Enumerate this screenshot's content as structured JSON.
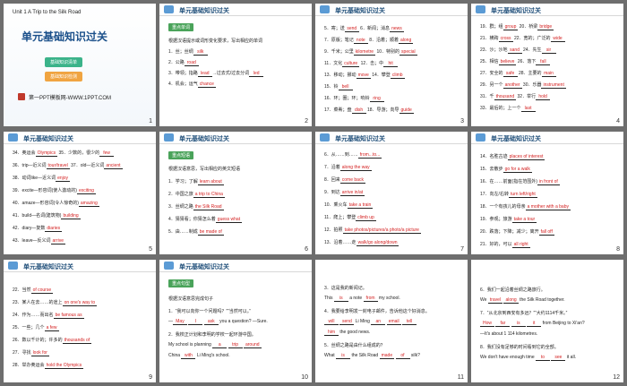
{
  "cover": {
    "unit": "Unit 1  A Trip to the Silk Road",
    "title": "单元基础知识过关",
    "badge1": "基础知识清单",
    "badge2": "基础知识检测",
    "footer": "第一PPT模板网-WWW.1PPT.COM",
    "num": "1"
  },
  "header_label": "单元基础知识过关",
  "slide2": {
    "tag": "重点单词",
    "intro": "根据汉语提示或词形变化要求，写出相应的单词",
    "lines": [
      {
        "pre": "1．丝；丝绸",
        "ans": "silk"
      },
      {
        "pre": "2．公路",
        "ans": "road"
      },
      {
        "pre": "3．带领；指路",
        "ans": "lead",
        "post": "→过去式/过去分词",
        "ans2": "led"
      },
      {
        "pre": "4．机会；运气",
        "ans": "chance"
      }
    ],
    "num": "2"
  },
  "slide3": {
    "lines": [
      {
        "pre": "5．寄；送",
        "ans": "send",
        "mid": "6．新闻；消息",
        "ans2": "news"
      },
      {
        "pre": "7．原版；笔记",
        "ans": "note",
        "mid": "8．沿着；顺着",
        "ans2": "along"
      },
      {
        "pre": "9．千米；公里",
        "ans": "kilometre",
        "mid": "10．特别的",
        "ans2": "special"
      },
      {
        "pre": "11．文化",
        "ans": "culture",
        "mid": "12．击；中",
        "ans2": "hit"
      },
      {
        "pre": "13．移动；挪动",
        "ans": "move",
        "mid": "14．攀登",
        "ans2": "climb"
      },
      {
        "pre": "15．铃",
        "ans": "bell"
      },
      {
        "pre": "16．环；圈；环；响铃",
        "ans": "ring"
      },
      {
        "pre": "17．菜肴；盘",
        "ans": "dish",
        "mid": "18．导游；向导",
        "ans2": "guide"
      }
    ],
    "num": "3"
  },
  "slide4": {
    "lines": [
      {
        "pre": "19．群；组",
        "ans": "group",
        "mid": "20．桥梁",
        "ans2": "bridge"
      },
      {
        "pre": "21．横跨",
        "ans": "cross",
        "mid": "22．宽的；广泛的",
        "ans2": "wide"
      },
      {
        "pre": "23．沙；沙地",
        "ans": "sand",
        "mid": "24．先生",
        "ans2": "sir"
      },
      {
        "pre": "25．相信",
        "ans": "believe",
        "mid": "26．落下",
        "ans2": "fall"
      },
      {
        "pre": "27．安全的",
        "ans": "safe",
        "mid": "28．主要的",
        "ans2": "main"
      },
      {
        "pre": "29．另一个",
        "ans": "another",
        "mid": "30．乐器",
        "ans2": "instrument"
      },
      {
        "pre": "31．千",
        "ans": "thousand",
        "mid": "32．举行",
        "ans2": "hold"
      },
      {
        "pre": "33．最后的；上一个",
        "ans": "last"
      }
    ],
    "num": "4"
  },
  "slide5": {
    "lines": [
      {
        "pre": "34．奥运会",
        "ans": "Olympics",
        "mid": "35．少数的，很少的",
        "ans2": "few"
      },
      {
        "pre": "36．trip—近义词",
        "ans": "tour/travel",
        "mid": "37．old—近义词",
        "ans2": "ancient"
      },
      {
        "pre": "38．动词like—近义词",
        "ans": "enjoy"
      },
      {
        "pre": "39．excite—形容词(使人激动的)",
        "ans": "exciting"
      },
      {
        "pre": "40．amaze—形容词(令人惊奇的)",
        "ans": "amazing"
      },
      {
        "pre": "41．build—名词(建筑物)",
        "ans": "building"
      },
      {
        "pre": "42．diary—复数",
        "ans": "diaries"
      },
      {
        "pre": "43．leave—反义词",
        "ans": "arrive"
      }
    ],
    "num": "5"
  },
  "slide6": {
    "tag": "重点短语",
    "intro": "根据汉语意思，写出相应的英文短语",
    "lines": [
      {
        "pre": "1．学习；了解",
        "ans": "learn about"
      },
      {
        "pre": "2．中国之旅",
        "ans": "a trip to China"
      },
      {
        "pre": "3．丝绸之路",
        "ans": "the Silk Road"
      },
      {
        "pre": "4．猜猜看；你猜怎么着",
        "ans": "guess what"
      },
      {
        "pre": "5．由……制成",
        "ans": "be made of"
      }
    ],
    "num": "6"
  },
  "slide7": {
    "lines": [
      {
        "pre": "6．从……到……",
        "ans": "from...to..."
      },
      {
        "pre": "7．沿着",
        "ans": "along the way"
      },
      {
        "pre": "8．回来",
        "ans": "come back"
      },
      {
        "pre": "9．到达",
        "ans": "arrive in/at"
      },
      {
        "pre": "10．乘火车",
        "ans": "take a train"
      },
      {
        "pre": "11．爬上；攀登",
        "ans": "climb up"
      },
      {
        "pre": "12．拍照",
        "ans": "take photos/pictures/a photo/a picture"
      },
      {
        "pre": "13．沿着……走",
        "ans": "walk/go along/down"
      }
    ],
    "num": "7"
  },
  "slide8": {
    "lines": [
      {
        "pre": "14．名胜古迹",
        "ans": "places of interest"
      },
      {
        "pre": "15．去散步",
        "ans": "go for a walk"
      },
      {
        "pre": "16．在……前面(指在范围外)",
        "ans": "in front of"
      },
      {
        "pre": "17．向左/右转",
        "ans": "turn left/right"
      },
      {
        "pre": "18．一个有孩儿的母亲",
        "ans": "a mother with a baby"
      },
      {
        "pre": "19．参观；旅游",
        "ans": "take a tour"
      },
      {
        "pre": "20．跌落；下降；减少；离开",
        "ans": "fall off"
      },
      {
        "pre": "21．好的，可以",
        "ans": "all right"
      }
    ],
    "num": "8"
  },
  "slide9": {
    "lines": [
      {
        "pre": "22．当然",
        "ans": "of course"
      },
      {
        "pre": "23．某人在去……的途上",
        "ans": "on one's way to"
      },
      {
        "pre": "24．作为……而出名",
        "ans": "be famous as"
      },
      {
        "pre": "25．一些；几个",
        "ans": "a few"
      },
      {
        "pre": "26．数以千计的；许多的",
        "ans": "thousands of"
      },
      {
        "pre": "27．寻找",
        "ans": "look for"
      },
      {
        "pre": "28．举办奥运会",
        "ans": "hold the Olympics"
      }
    ],
    "num": "9"
  },
  "slide10": {
    "tag": "重点句型",
    "intro": "根据汉语意思完成句子",
    "s1": "1．“我可以向你一个问题吗？”“当然可以。”",
    "s1a_pre": "—",
    "s1a": "May",
    "s1b": "I",
    "s1c": "ask",
    "s1_post": "you a question? —Sure.",
    "s2": "2．我校正计划和李明的学校一起环游中国。",
    "s2a_pre": "My school is planning",
    "s2a": "a",
    "s2b": "trip",
    "s2c": "around",
    "s2b_pre": "China",
    "s2d": "with",
    "s2_post": "Li Ming's school.",
    "num": "10"
  },
  "slide11": {
    "s3": "3．这是我的新闻记。",
    "s3a_pre": "This",
    "s3a": "is",
    "s3a_mid": "a note",
    "s3b": "from",
    "s3_post": "my school.",
    "s4": "4．我要给李明发一封电子邮件，告诉他这个好消息。",
    "s4a": "will",
    "s4b": "send",
    "s4a_mid": "Li Ming",
    "s4c": "an",
    "s4d": "email",
    "s4e": "tell",
    "s4f": "him",
    "s4_post": "the good news.",
    "s5": "5．丝绸之路是由什么组成的？",
    "s5a_pre": "What",
    "s5a": "is",
    "s5_mid": "the Silk Road",
    "s5b": "made",
    "s5c": "of",
    "s5_post": "silk?",
    "num": "11"
  },
  "slide12": {
    "s6": "6．我们一起沿着丝绸之路旅行。",
    "s6a_pre": "We",
    "s6a": "travel",
    "s6b": "along",
    "s6_post": "the Silk Road together.",
    "s7": "7．“从北京到西安有多远？”“大约1114千米。”",
    "s7a": "How",
    "s7b": "far",
    "s7c": "is",
    "s7d": "it",
    "s7_post": "from Beijing to Xi'an?",
    "s7_answer": "—It's about 1 114 kilometres.",
    "s8": "8．我们没有足够的时间看到它的全部。",
    "s8a_pre": "We don't have enough time",
    "s8a": "to",
    "s8b": "see",
    "s8_post": "it all.",
    "num": "12"
  }
}
